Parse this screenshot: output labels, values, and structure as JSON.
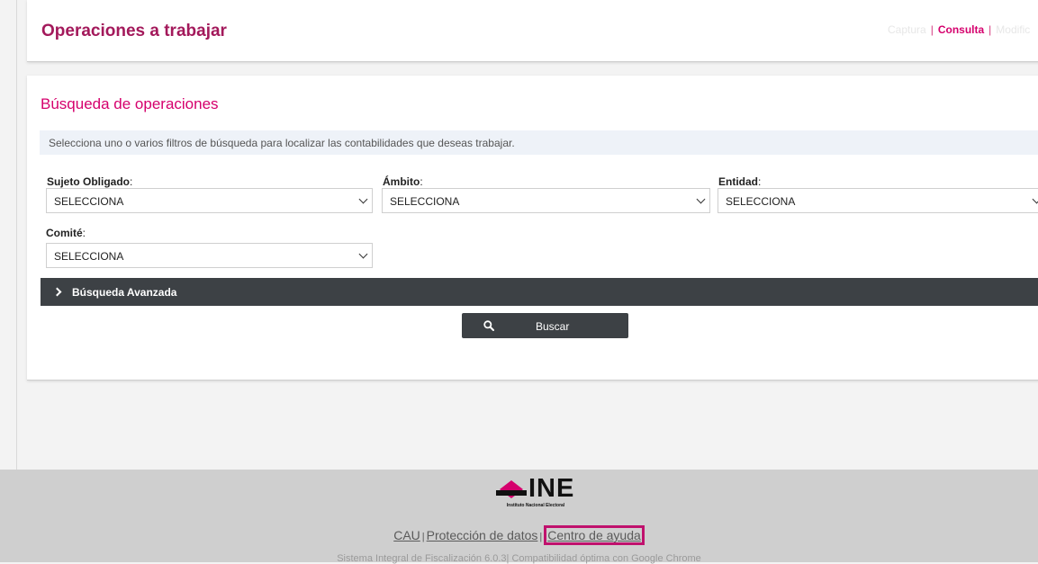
{
  "header": {
    "title": "Operaciones a trabajar",
    "nav": {
      "capture": "Captura",
      "consult": "Consulta",
      "modify": "Modific",
      "separator": "|"
    }
  },
  "search": {
    "title": "Búsqueda de operaciones",
    "info": "Selecciona uno o varios filtros de búsqueda para localizar las contabilidades que deseas trabajar.",
    "fields": {
      "sujeto": {
        "label": "Sujeto Obligado",
        "colon": ":",
        "value": "SELECCIONA"
      },
      "ambito": {
        "label": "Ámbito",
        "colon": ":",
        "value": "SELECCIONA"
      },
      "entidad": {
        "label": "Entidad",
        "colon": ":",
        "value": "SELECCIONA"
      },
      "comite": {
        "label": "Comité",
        "colon": ":",
        "value": "SELECCIONA"
      }
    },
    "advanced_label": "Búsqueda Avanzada",
    "button_label": "Buscar"
  },
  "footer": {
    "logo_text": "INE",
    "logo_subtitle": "Instituto Nacional Electoral",
    "links": {
      "cau": "CAU",
      "privacy": "Protección de datos",
      "help": "Centro de ayuda",
      "separator": "|"
    },
    "version": "Sistema Integral de Fiscalización 6.0.3| Compatibilidad óptima con Google Chrome"
  },
  "colors": {
    "brand": "#a3195b",
    "accent": "#d5006d",
    "dark_bar": "#3d4145",
    "highlight_box": "#c0116d"
  },
  "icons": [
    "search-icon",
    "chevron-down-icon",
    "chevron-right-icon",
    "ine-logo-icon"
  ]
}
